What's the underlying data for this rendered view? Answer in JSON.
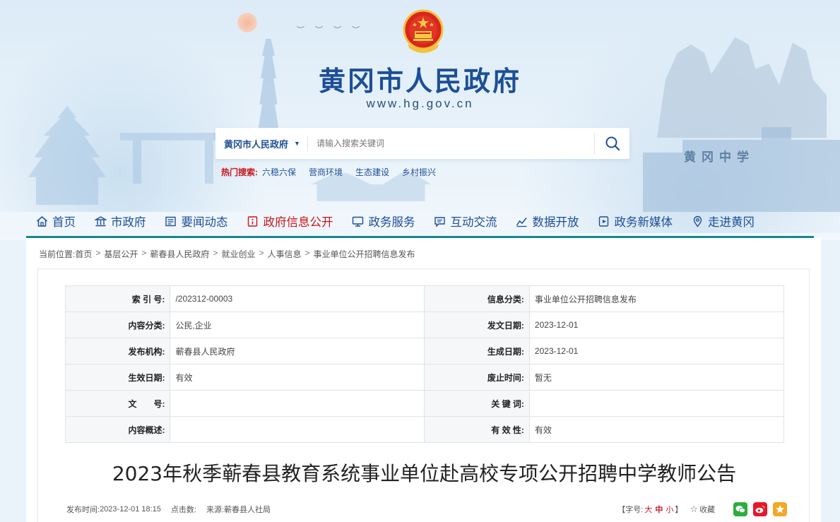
{
  "header": {
    "title": "黄冈市人民政府",
    "url": "www.hg.gov.cn",
    "school_label": "黄冈中学"
  },
  "search": {
    "scope": "黄冈市人民政府",
    "placeholder": "请输入搜索关键词",
    "hot_label": "热门搜索:",
    "hot_items": [
      "六稳六保",
      "营商环境",
      "生态建设",
      "乡村振兴"
    ]
  },
  "nav": {
    "items": [
      {
        "label": "首页",
        "icon": "home-icon"
      },
      {
        "label": "市政府",
        "icon": "building-icon"
      },
      {
        "label": "要闻动态",
        "icon": "newspaper-icon"
      },
      {
        "label": "政府信息公开",
        "icon": "info-icon",
        "active": true
      },
      {
        "label": "政务服务",
        "icon": "monitor-icon"
      },
      {
        "label": "互动交流",
        "icon": "chat-icon"
      },
      {
        "label": "数据开放",
        "icon": "chart-icon"
      },
      {
        "label": "政务新媒体",
        "icon": "media-icon"
      },
      {
        "label": "走进黄冈",
        "icon": "location-icon"
      }
    ]
  },
  "breadcrumb": {
    "prefix": "当前位置:",
    "items": [
      "首页",
      "基层公开",
      "蕲春县人民政府",
      "就业创业",
      "人事信息",
      "事业单位公开招聘信息发布"
    ]
  },
  "meta": {
    "rows": [
      {
        "l_label": "索 引 号:",
        "l_value": "/202312-00003",
        "r_label": "信息分类:",
        "r_value": "事业单位公开招聘信息发布"
      },
      {
        "l_label": "内容分类:",
        "l_value": "公民,企业",
        "r_label": "发文日期:",
        "r_value": "2023-12-01"
      },
      {
        "l_label": "发布机构:",
        "l_value": "蕲春县人民政府",
        "r_label": "生成日期:",
        "r_value": "2023-12-01"
      },
      {
        "l_label": "生效日期:",
        "l_value": "有效",
        "r_label": "废止时间:",
        "r_value": "暂无"
      },
      {
        "l_label": "文　　号:",
        "l_value": "",
        "r_label": "关 键 词:",
        "r_value": ""
      },
      {
        "l_label": "内容概述:",
        "l_value": "",
        "r_label": "有 效 性:",
        "r_value": "有效"
      }
    ]
  },
  "article": {
    "title": "2023年秋季蕲春县教育系统事业单位赴高校专项公开招聘中学教师公告",
    "publish_label": "发布时间:",
    "publish_time": "2023-12-01 18:15",
    "clicks_label": "点击数:",
    "source_label": "来源:",
    "source": "蕲春县人社局",
    "font_label_open": "【字号:",
    "font_big": "大",
    "font_mid": "中",
    "font_small": "小",
    "font_label_close": "】",
    "favorite": "收藏"
  },
  "colors": {
    "brand_blue": "#1d4f96",
    "accent_red": "#c8161d",
    "nav_line": "#17868d",
    "wechat": "#2aae3e",
    "weibo": "#e6162d",
    "qzone": "#f5a623"
  }
}
